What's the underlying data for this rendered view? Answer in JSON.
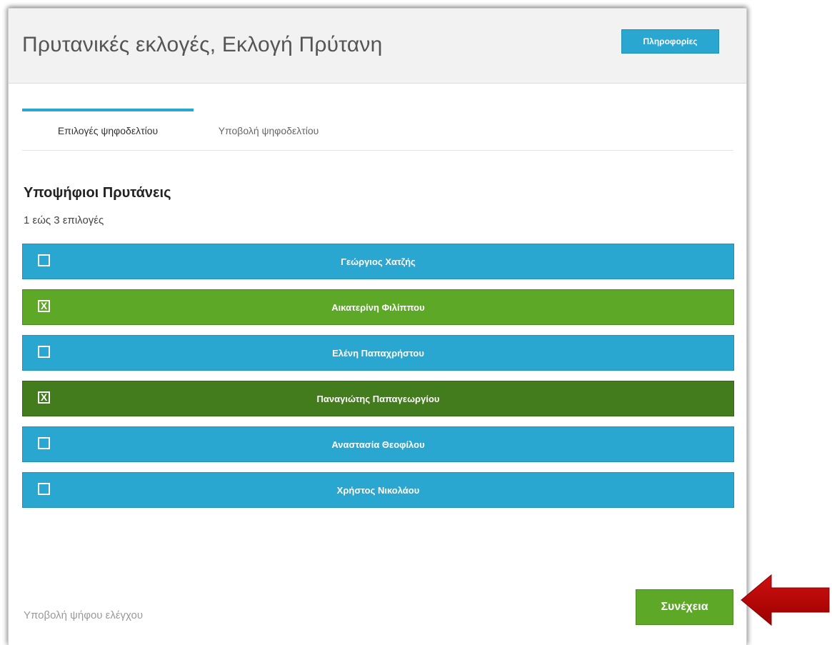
{
  "header": {
    "title": "Πρυτανικές εκλογές, Εκλογή Πρύτανη",
    "info_button": "Πληροφορίες"
  },
  "tabs": [
    {
      "label": "Επιλογές ψηφοδελτίου",
      "active": true
    },
    {
      "label": "Υποβολή ψηφοδελτίου",
      "active": false
    }
  ],
  "ballot": {
    "section_title": "Υποψήφιοι Πρυτάνεις",
    "choices_hint": "1 εώς 3 επιλογές",
    "checked_mark": "X",
    "candidates": [
      {
        "name": "Γεώργιος Χατζής",
        "checked": false
      },
      {
        "name": "Αικατερίνη Φιλίππου",
        "checked": true
      },
      {
        "name": "Ελένη Παπαχρήστου",
        "checked": false
      },
      {
        "name": "Παναγιώτης Παπαγεωργίου",
        "checked": true
      },
      {
        "name": "Αναστασία Θεοφίλου",
        "checked": false
      },
      {
        "name": "Χρήστος Νικολάου",
        "checked": false
      }
    ]
  },
  "footer": {
    "test_vote_link": "Υποβολή ψήφου ελέγχου",
    "continue_button": "Συνέχεια"
  },
  "colors": {
    "accent_blue": "#29a7d0",
    "selected_green": "#5ea828",
    "selected_green_dark": "#437c1c",
    "arrow_red": "#c00000"
  },
  "icons": {
    "annotation": "red-arrow-left-icon",
    "checkbox": "checkbox-icon"
  }
}
